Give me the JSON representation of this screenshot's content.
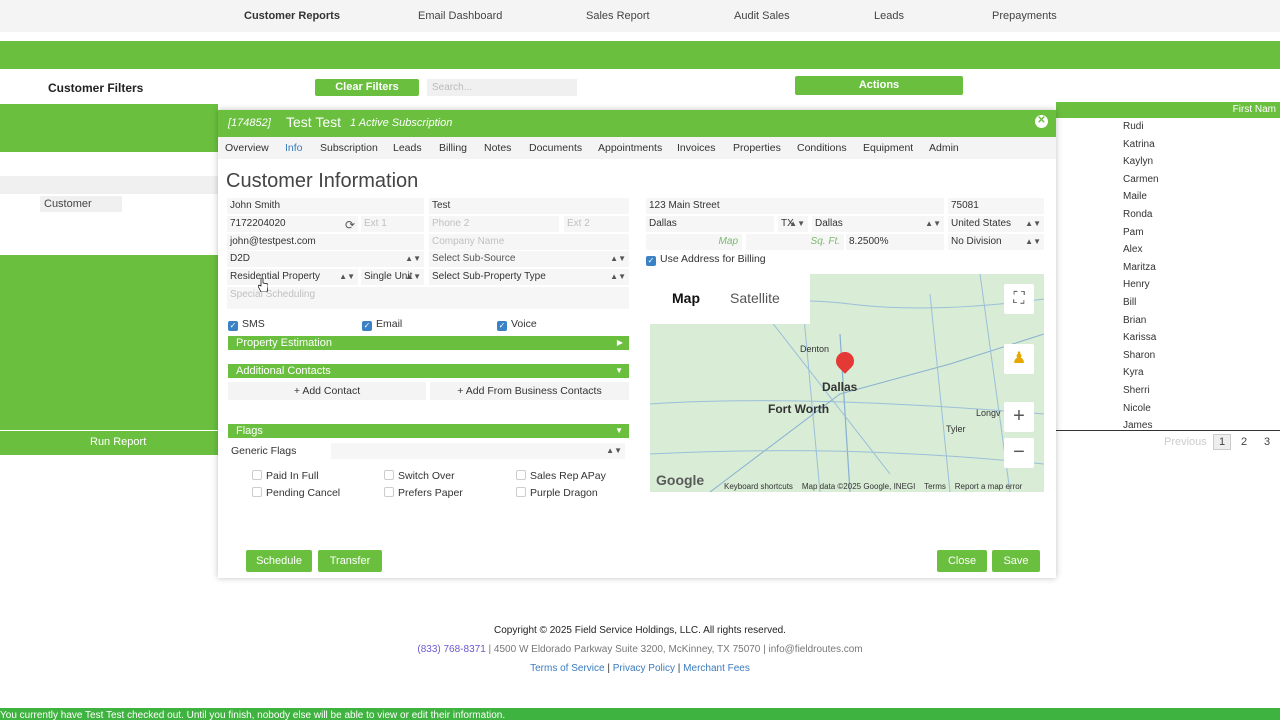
{
  "topnav": [
    "Customer Reports",
    "Email Dashboard",
    "Sales Report",
    "Audit Sales",
    "Leads",
    "Prepayments"
  ],
  "filters": {
    "title": "Customer Filters",
    "clear": "Clear Filters",
    "search_placeholder": "Search...",
    "actions": "Actions"
  },
  "left": {
    "customer": "Customer",
    "run_report": "Run Report"
  },
  "right": {
    "first_name_header": "First Nam",
    "names": [
      "Rudi",
      "Katrina",
      "Kaylyn",
      "Carmen",
      "Maile",
      "Ronda",
      "Pam",
      "Alex",
      "Maritza",
      "Henry",
      "Bill",
      "Brian",
      "Karissa",
      "Sharon",
      "Kyra",
      "Sherri",
      "Nicole",
      "James"
    ],
    "pager": {
      "prev": "Previous",
      "p1": "1",
      "p2": "2",
      "p3": "3"
    }
  },
  "modal": {
    "id": "[174852]",
    "name": "Test Test",
    "subscription": "1 Active Subscription",
    "tabs": [
      "Overview",
      "Info",
      "Subscription",
      "Leads",
      "Billing",
      "Notes",
      "Documents",
      "Appointments",
      "Invoices",
      "Properties",
      "Conditions",
      "Equipment",
      "Admin"
    ],
    "title": "Customer Information",
    "first_name": "John Smith",
    "last_name": "Test",
    "phone1": "7172204020",
    "ext1": "Ext 1",
    "phone2": "Phone 2",
    "ext2": "Ext 2",
    "email": "john@testpest.com",
    "company": "Company Name",
    "source": "D2D",
    "sub_source": "Select Sub-Source",
    "property_type": "Residential Property",
    "unit": "Single Unit",
    "sub_property": "Select Sub-Property Type",
    "special": "Special Scheduling",
    "sms": "SMS",
    "email_label": "Email",
    "voice": "Voice",
    "property_estimation": "Property Estimation",
    "additional_contacts": "Additional Contacts",
    "add_contact": "+ Add Contact",
    "add_business": "+ Add From Business Contacts",
    "flags": "Flags",
    "generic_flags": "Generic Flags",
    "flag_items": [
      "Paid In Full",
      "Switch Over",
      "Sales Rep APay",
      "Pending Cancel",
      "Prefers Paper",
      "Purple Dragon"
    ],
    "address": "123 Main Street",
    "zip": "75081",
    "city": "Dallas",
    "state": "TX",
    "county": "Dallas",
    "country": "United States",
    "map_link": "Map",
    "sqft": "Sq. Ft.",
    "tax": "8.2500%",
    "division": "No Division",
    "use_billing": "Use Address for Billing",
    "map": {
      "tab_map": "Map",
      "tab_satellite": "Satellite",
      "cities": [
        "Denton",
        "Dallas",
        "Fort Worth",
        "Tyler",
        "Longv"
      ],
      "google": "Google",
      "footer": [
        "Keyboard shortcuts",
        "Map data ©2025 Google, INEGI",
        "Terms",
        "Report a map error"
      ]
    },
    "buttons": {
      "schedule": "Schedule",
      "transfer": "Transfer",
      "close": "Close",
      "save": "Save"
    }
  },
  "footer": {
    "copyright": "Copyright © 2025 Field Service Holdings, LLC. All rights reserved.",
    "phone": "(833) 768-8371",
    "address": "| 4500 W Eldorado Parkway Suite 3200, McKinney, TX 75070 | info@fieldroutes.com",
    "links": [
      "Terms of Service",
      "Privacy Policy",
      "Merchant Fees"
    ]
  },
  "banner": "You currently have Test Test checked out. Until you finish, nobody else will be able to view or edit their information.",
  "colors": {
    "brand_green": "#6abf3f",
    "link_blue": "#3a7bbf",
    "checkbox_blue": "#3b82c4"
  }
}
